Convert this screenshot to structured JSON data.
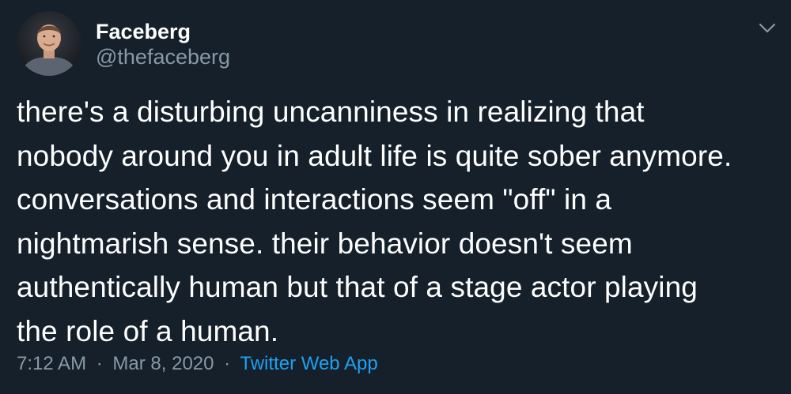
{
  "author": {
    "name": "Faceberg",
    "handle": "@thefaceberg"
  },
  "tweet": {
    "lines": [
      "there's a disturbing uncanniness in realizing that",
      "nobody around you in adult life is quite sober anymore.",
      "conversations and interactions seem \"off\" in a",
      "nightmarish sense. their behavior doesn't seem",
      "authentically human but that of a stage actor playing",
      "the role of a human."
    ]
  },
  "meta": {
    "time": "7:12 AM",
    "separator": "·",
    "date": "Mar 8, 2020",
    "source": "Twitter Web App"
  },
  "icons": {
    "more": "chevron-down-icon"
  },
  "colors": {
    "background": "#15202b",
    "primary_text": "#ffffff",
    "secondary_text": "#8899a6",
    "link": "#1da1f2"
  }
}
